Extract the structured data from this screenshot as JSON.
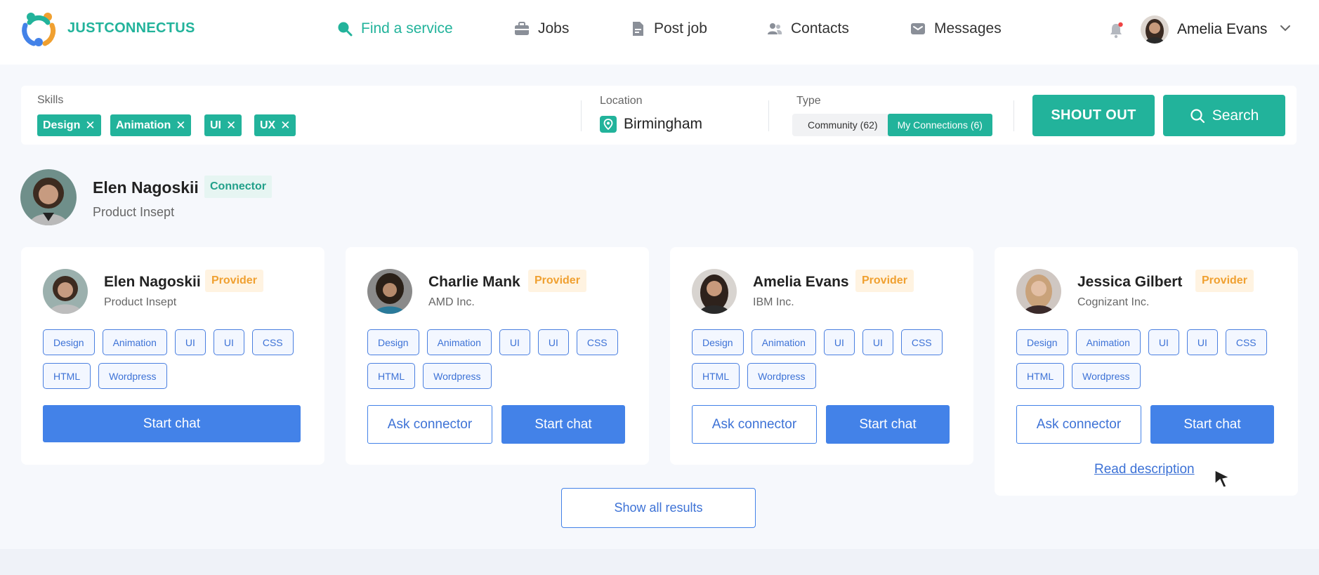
{
  "header": {
    "brand": "JUSTCONNECTUS",
    "nav": [
      {
        "label": "Find a service",
        "icon": "search-icon",
        "active": true
      },
      {
        "label": "Jobs",
        "icon": "briefcase-icon"
      },
      {
        "label": "Post job",
        "icon": "document-icon"
      },
      {
        "label": "Contacts",
        "icon": "contacts-icon"
      },
      {
        "label": "Messages",
        "icon": "mail-icon"
      }
    ],
    "user_name": "Amelia Evans"
  },
  "filters": {
    "skills_label": "Skills",
    "skills": [
      "Design",
      "Animation",
      "UI",
      "UX"
    ],
    "location_label": "Location",
    "location_value": "Birmingham",
    "type_label": "Type",
    "type_options": [
      "Community (62)",
      "My Connections (6)"
    ],
    "type_selected": "My Connections (6)",
    "shout_out_label": "SHOUT OUT",
    "search_label": "Search"
  },
  "connector": {
    "name": "Elen Nagoskii",
    "badge": "Connector",
    "title": "Product Insept"
  },
  "cards": [
    {
      "name": "Elen Nagoskii",
      "badge": "Provider",
      "company": "Product Insept",
      "tags": [
        "Design",
        "Animation",
        "UI",
        "UI",
        "CSS",
        "HTML",
        "Wordpress"
      ],
      "primary_label": "Start chat"
    },
    {
      "name": "Charlie Mank",
      "badge": "Provider",
      "company": "AMD Inc.",
      "tags": [
        "Design",
        "Animation",
        "UI",
        "UI",
        "CSS",
        "HTML",
        "Wordpress"
      ],
      "secondary_label": "Ask connector",
      "primary_label": "Start chat"
    },
    {
      "name": "Amelia Evans",
      "badge": "Provider",
      "company": "IBM Inc.",
      "tags": [
        "Design",
        "Animation",
        "UI",
        "UI",
        "CSS",
        "HTML",
        "Wordpress"
      ],
      "secondary_label": "Ask connector",
      "primary_label": "Start chat"
    },
    {
      "name": "Jessica Gilbert",
      "badge": "Provider",
      "company": "Cognizant Inc.",
      "tags": [
        "Design",
        "Animation",
        "UI",
        "UI",
        "CSS",
        "HTML",
        "Wordpress"
      ],
      "secondary_label": "Ask connector",
      "primary_label": "Start chat",
      "link_label": "Read description"
    }
  ],
  "show_all_label": "Show all results",
  "colors": {
    "brand_teal": "#22b39b",
    "primary_blue": "#4382e8",
    "provider_orange": "#f0a030",
    "notification_red": "#ef4444"
  }
}
